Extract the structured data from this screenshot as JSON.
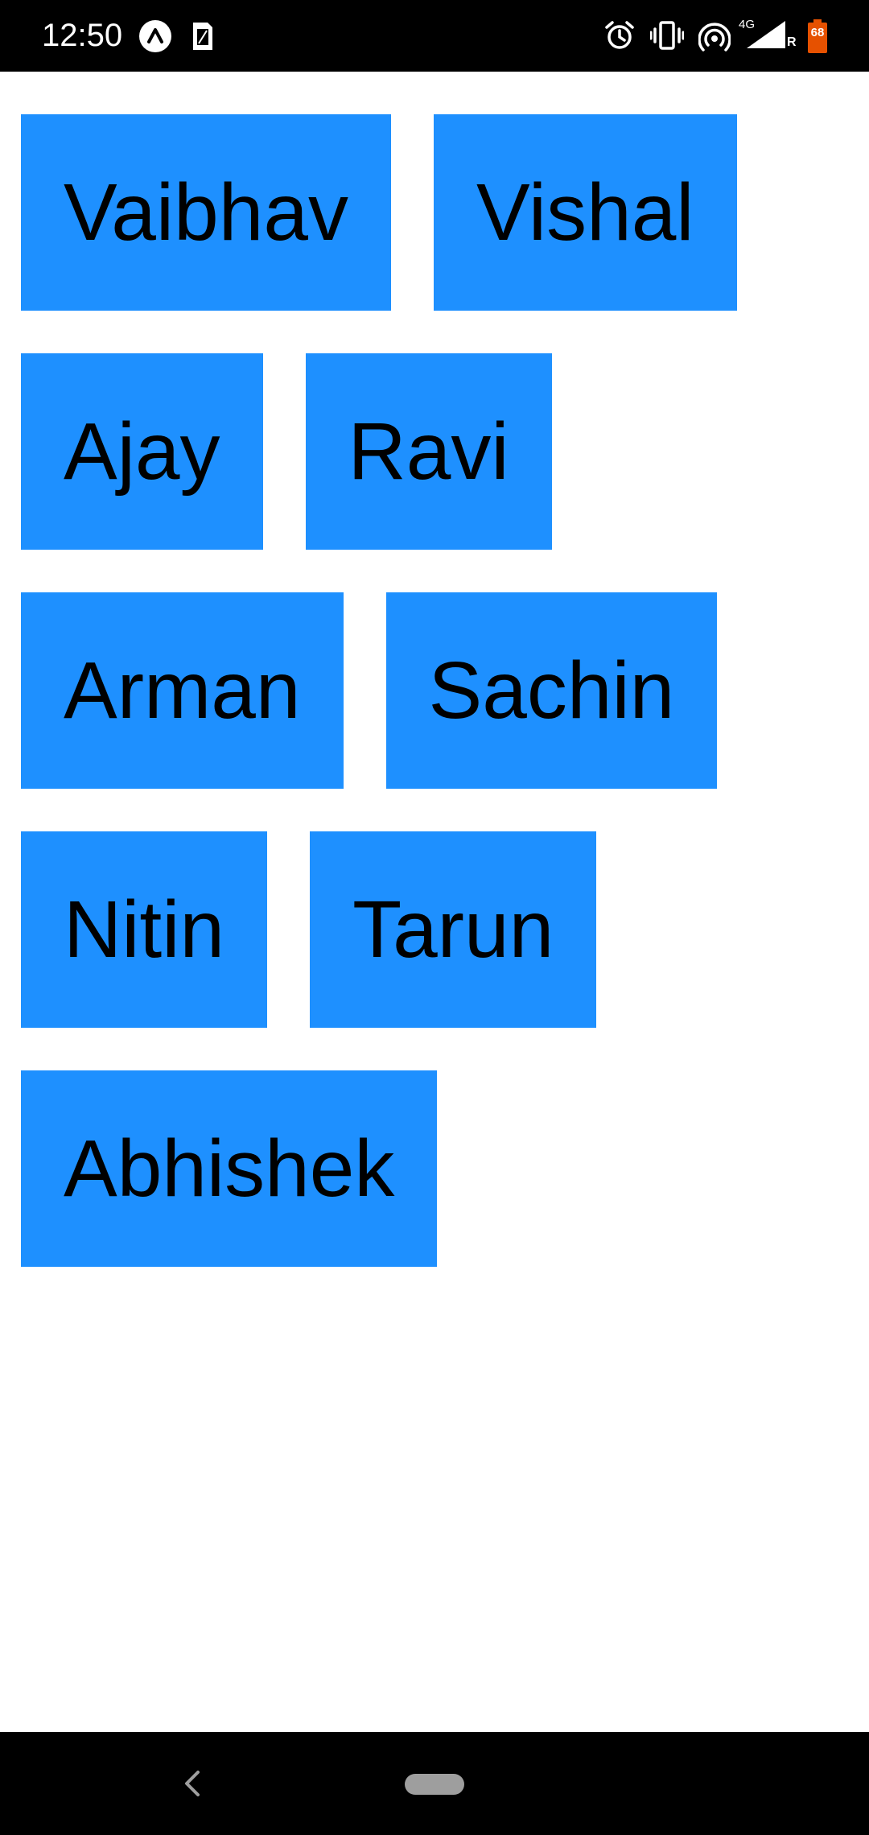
{
  "status_bar": {
    "time": "12:50",
    "left_icons": [
      "expo-icon",
      "sim-card-icon"
    ],
    "right_icons": [
      "alarm-icon",
      "vibrate-icon",
      "hotspot-icon",
      "signal-icon",
      "battery-icon"
    ],
    "network_label": "4G",
    "roaming_label": "R",
    "battery_level": "68"
  },
  "chips": [
    {
      "label": "Vaibhav"
    },
    {
      "label": "Vishal"
    },
    {
      "label": "Ajay"
    },
    {
      "label": "Ravi"
    },
    {
      "label": "Arman"
    },
    {
      "label": "Sachin"
    },
    {
      "label": "Nitin"
    },
    {
      "label": "Tarun"
    },
    {
      "label": "Abhishek"
    }
  ],
  "colors": {
    "chip_background": "#1e90ff",
    "chip_text": "#000000",
    "status_bar": "#000000",
    "nav_bar": "#000000"
  },
  "nav_bar": {
    "icons": [
      "back-icon",
      "home-pill-icon"
    ]
  }
}
